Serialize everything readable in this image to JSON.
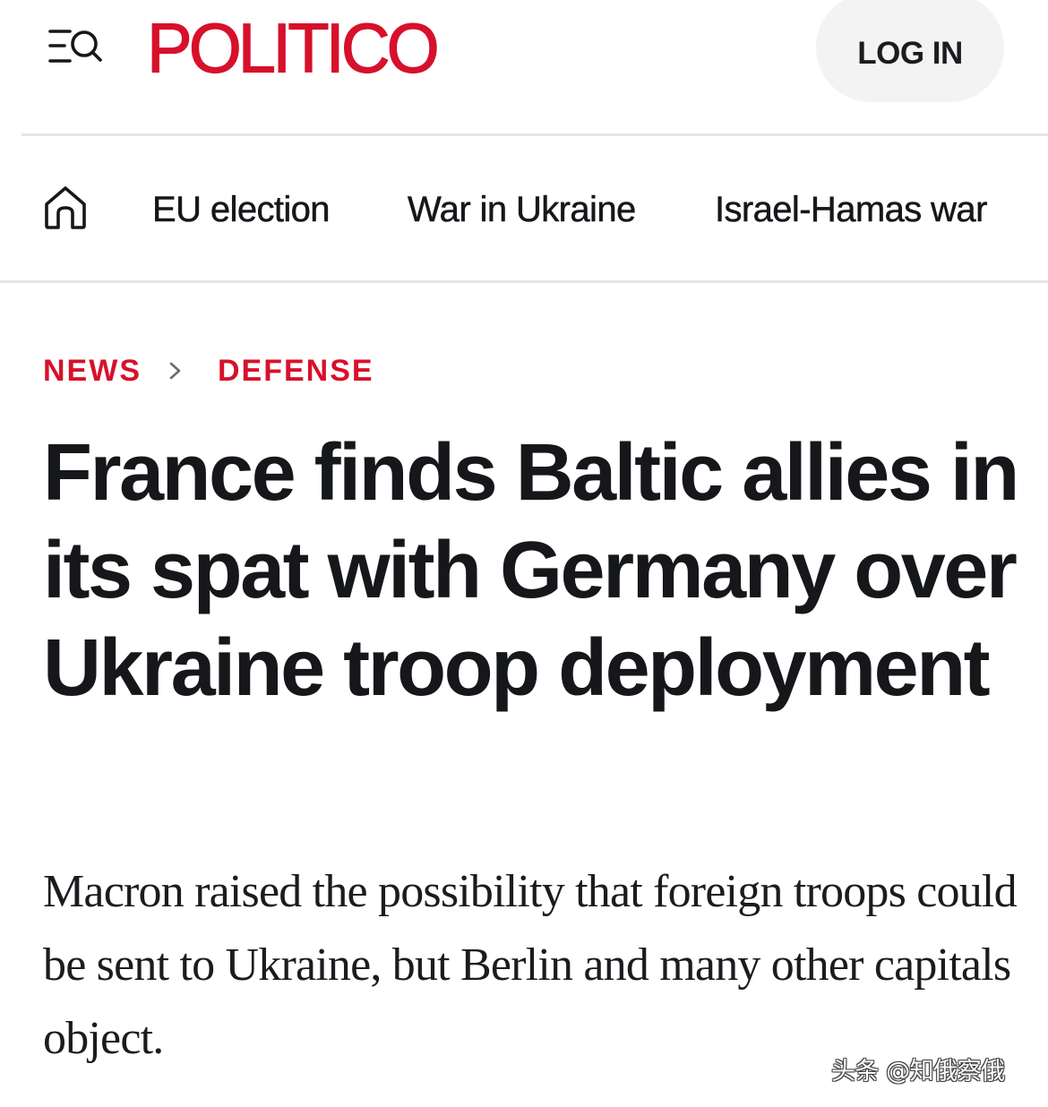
{
  "header": {
    "logo_text": "POLITICO",
    "login_label": "LOG IN",
    "brand_color": "#d7112b",
    "menu_icon": "menu-search-icon"
  },
  "section_nav": {
    "home_icon": "home-icon",
    "items": [
      {
        "label": "EU election"
      },
      {
        "label": "War in Ukraine"
      },
      {
        "label": "Israel-Hamas war"
      }
    ]
  },
  "breadcrumb": {
    "items": [
      {
        "label": "NEWS"
      },
      {
        "label": "DEFENSE"
      }
    ],
    "separator_icon": "chevron-right-icon"
  },
  "article": {
    "headline": "France finds Baltic allies in its spat with Germany over Ukraine troop deployment",
    "dek": "Macron raised the possibility that foreign troops could be sent to Ukraine, but Berlin and many other capitals object."
  },
  "watermark": {
    "text": "头条 @知俄察俄"
  }
}
